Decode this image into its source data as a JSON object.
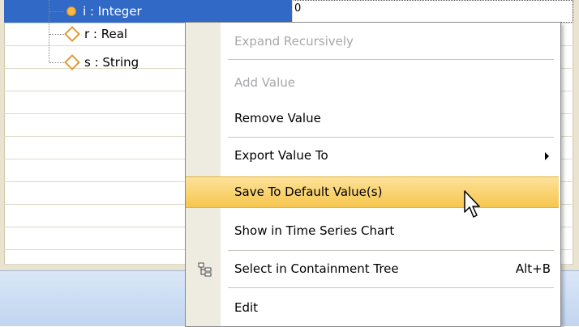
{
  "tree": {
    "nodes": [
      {
        "label": "i : Integer",
        "icon": "filled-circle-icon",
        "selected": true
      },
      {
        "label": "r : Real",
        "icon": "diamond-icon",
        "selected": false
      },
      {
        "label": "s : String",
        "icon": "diamond-icon",
        "selected": false
      }
    ],
    "selected_value_cell": "0"
  },
  "context_menu": {
    "items": [
      {
        "label": "Expand Recursively",
        "enabled": false
      },
      {
        "label": "Add Value",
        "enabled": false
      },
      {
        "label": "Remove Value",
        "enabled": true
      },
      {
        "label": "Export Value To",
        "enabled": true,
        "submenu": true
      },
      {
        "label": "Save To Default Value(s)",
        "enabled": true,
        "highlighted": true
      },
      {
        "label": "Show in Time Series Chart",
        "enabled": true
      },
      {
        "label": "Select in Containment Tree",
        "enabled": true,
        "shortcut": "Alt+B",
        "icon": "containment-tree-icon"
      },
      {
        "label": "Edit",
        "enabled": true
      }
    ]
  },
  "colors": {
    "selection": "#3169c6",
    "menu_highlight": "#f6c64d",
    "disabled_text": "#a7a6aa"
  }
}
